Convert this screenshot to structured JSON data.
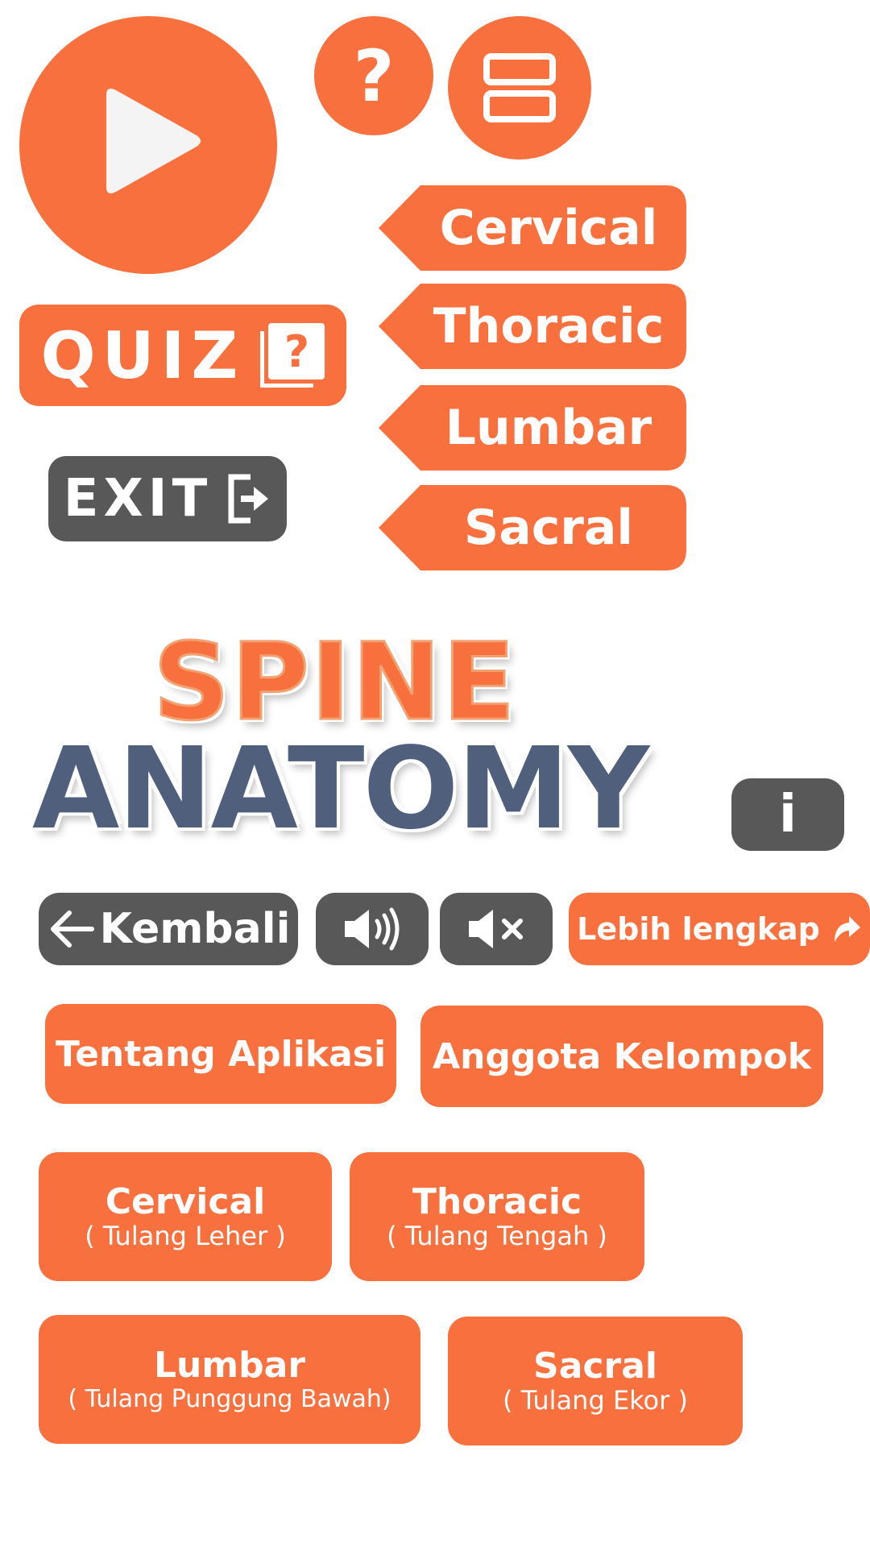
{
  "top_buttons": {
    "play_icon": "play-icon",
    "help_glyph": "?",
    "menu_icon": "menu-icon"
  },
  "regions": [
    "Cervical",
    "Thoracic",
    "Lumbar",
    "Sacral"
  ],
  "quiz": {
    "label": "QUIZ",
    "icon_glyph": "?"
  },
  "exit": {
    "label": "EXIT"
  },
  "logo": {
    "line1": "SPINE",
    "line2": "ANATOMY"
  },
  "info": {
    "glyph": "i"
  },
  "toolbar": {
    "back_label": "Kembali",
    "more_label": "Lebih lengkap"
  },
  "menu": {
    "about_label": "Tentang Aplikasi",
    "members_label": "Anggota Kelompok"
  },
  "sections": [
    {
      "title": "Cervical",
      "subtitle": "( Tulang Leher )"
    },
    {
      "title": "Thoracic",
      "subtitle": "( Tulang Tengah )"
    },
    {
      "title": "Lumbar",
      "subtitle": "( Tulang Punggung Bawah)"
    },
    {
      "title": "Sacral",
      "subtitle": "( Tulang Ekor )"
    }
  ],
  "colors": {
    "accent": "#F8703E",
    "dark": "#585858",
    "logo_blue": "#4F5F7C"
  }
}
